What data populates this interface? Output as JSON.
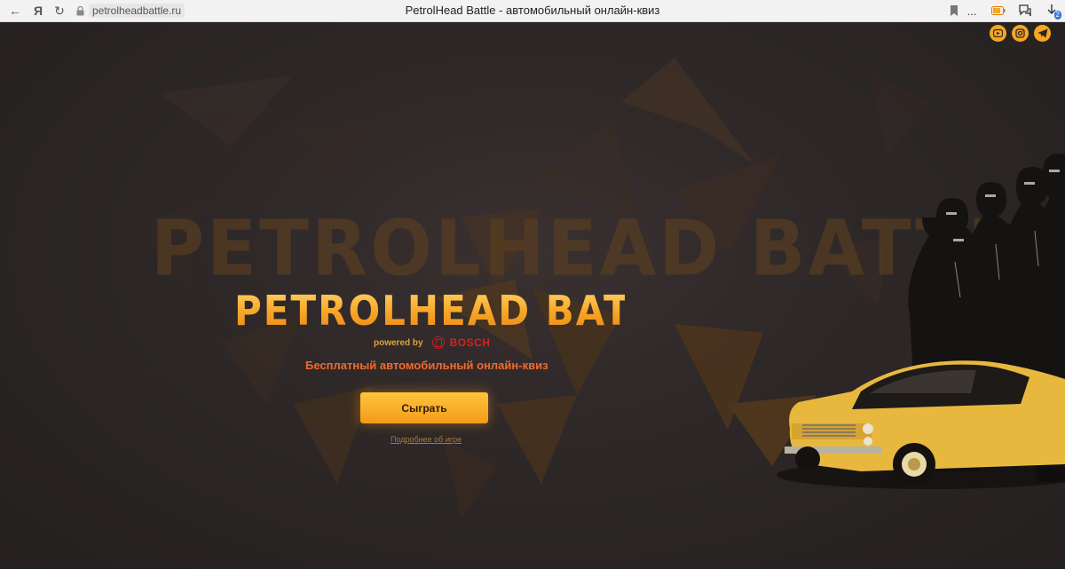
{
  "browser": {
    "back_icon": "arrow-left",
    "yandex_label": "Я",
    "reload_icon": "reload",
    "url": "petrolheadbattle.ru",
    "tab_title": "PetrolHead Battle - автомобильный онлайн-квиз",
    "more_label": "...",
    "download_badge": "2"
  },
  "social": {
    "items": [
      "youtube-icon",
      "instagram-icon",
      "telegram-icon"
    ],
    "color": "#f5a623"
  },
  "hero": {
    "watermark": "PETROLHEAD BATTLE",
    "title": "PETROLHEAD BATTLE",
    "powered_by": "powered by",
    "sponsor": "BOSCH",
    "tagline": "Бесплатный автомобильный онлайн-квиз",
    "play_button": "Сыграть",
    "more_link": "Подробнее об игре"
  },
  "colors": {
    "accent": "#f7a425",
    "tagline": "#f26a2a",
    "sponsor": "#d9201f",
    "background": "#2b2525"
  }
}
